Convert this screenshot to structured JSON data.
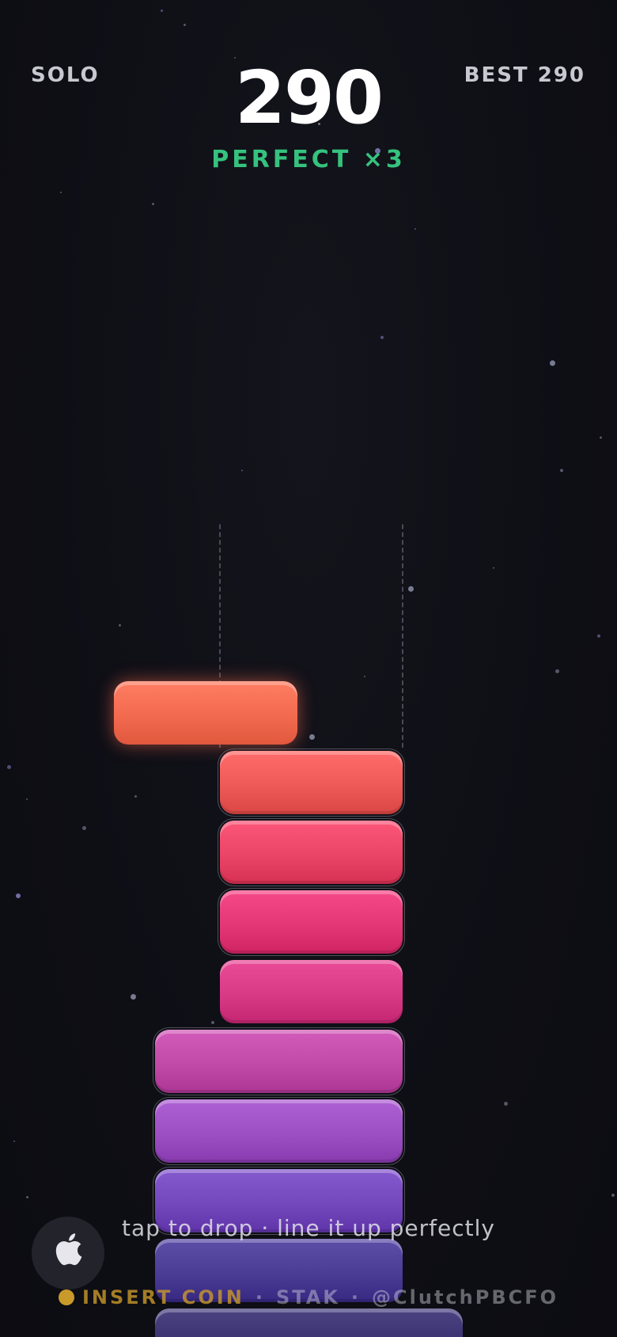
{
  "hud": {
    "mode": "SOLO",
    "score": "290",
    "best": "BEST 290",
    "combo": "PERFECT ×3"
  },
  "moving_block": {
    "color": "#f26a4f"
  },
  "stack": [
    {
      "color": "#ed5a58"
    },
    {
      "color": "#ea4466"
    },
    {
      "color": "#e43876"
    },
    {
      "color": "#d83a86"
    },
    {
      "color": "#c14aa8"
    },
    {
      "color": "#9c4fc2"
    },
    {
      "color": "#7448bd"
    },
    {
      "color": "#4b3c96"
    },
    {
      "color": "#3a3270"
    }
  ],
  "hint": "tap to drop · line it up perfectly",
  "apple_icon": "apple-icon",
  "footer": {
    "coin_icon": "coin-icon",
    "insert_coin": "INSERT COIN",
    "separator": "·",
    "game": "STAK",
    "handle": "@ClutchPBCFO"
  }
}
